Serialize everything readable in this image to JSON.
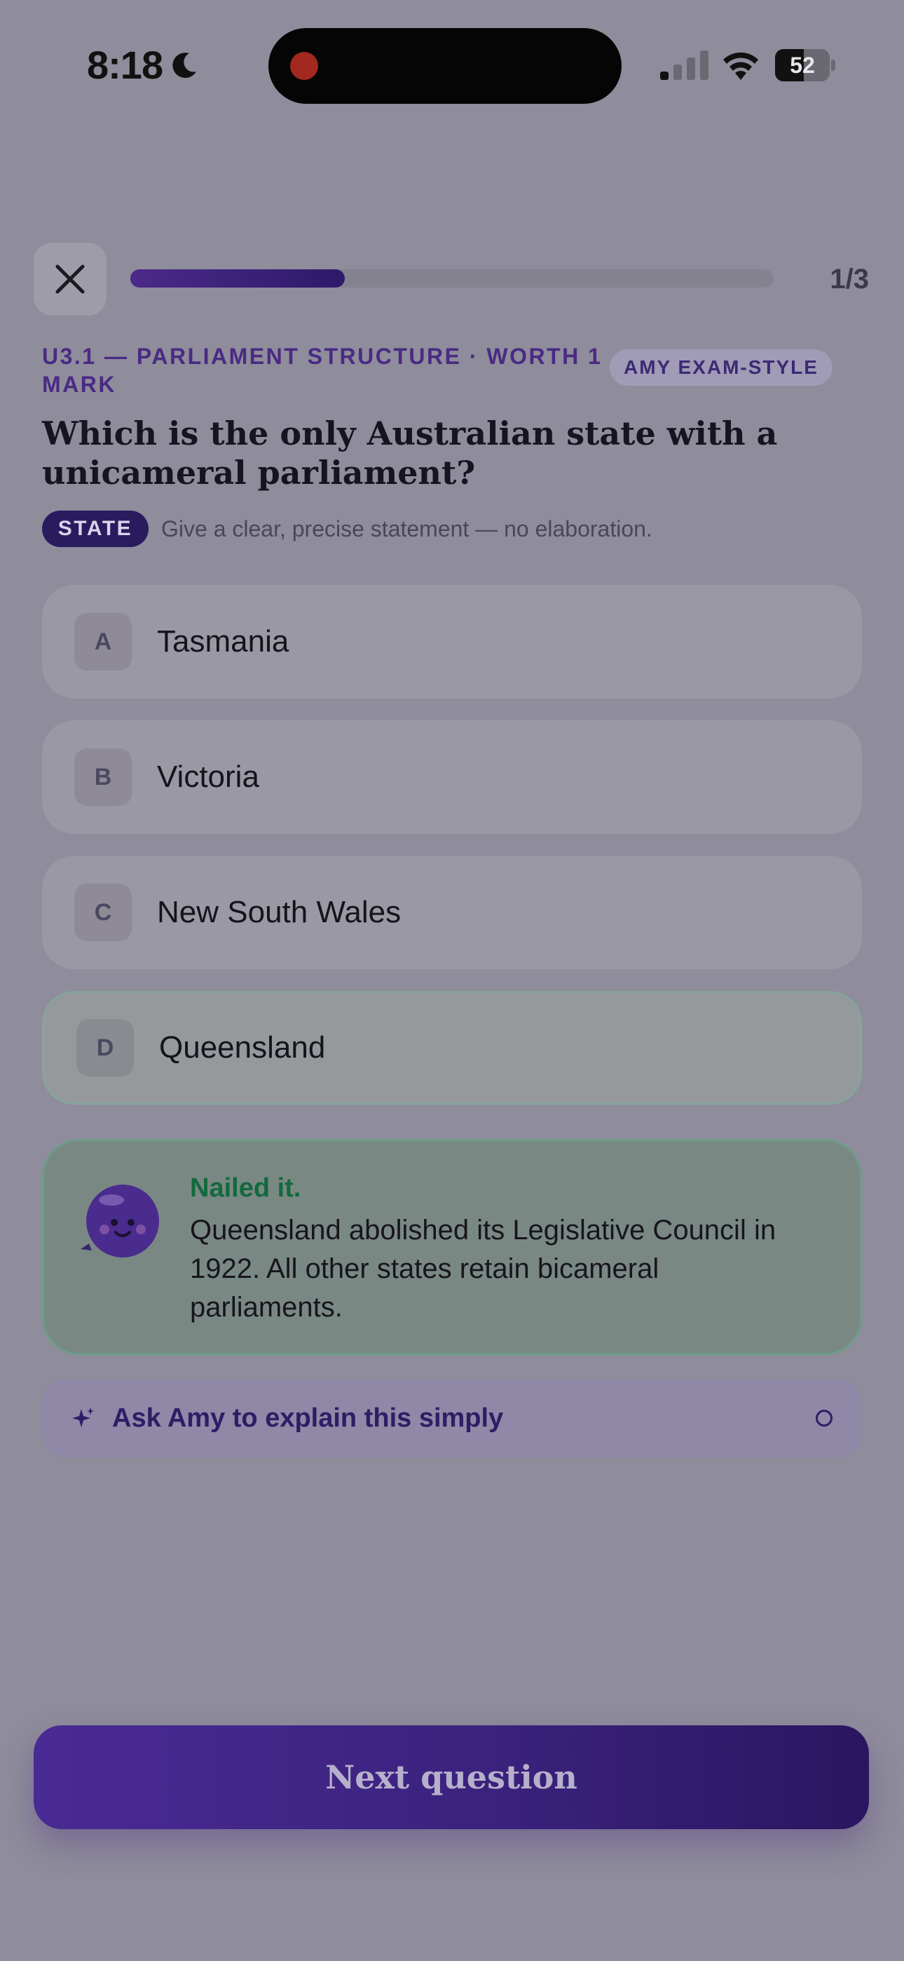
{
  "status_bar": {
    "time": "8:18",
    "battery_label": "52",
    "battery_level": 52,
    "icons": [
      "moon-icon",
      "record-dot-icon",
      "cellular-signal-icon",
      "wifi-icon",
      "battery-icon"
    ]
  },
  "header": {
    "close_icon": "close-icon",
    "progress_current": 1,
    "progress_total": 3,
    "progress_label": "1/3"
  },
  "question": {
    "meta": "U3.1 — PARLIAMENT STRUCTURE · WORTH 1 MARK",
    "badge": "AMY EXAM-STYLE",
    "text": "Which is the only Australian state with a unicameral parliament?",
    "command_word": "STATE",
    "instruction": "Give a clear, precise statement — no elaboration."
  },
  "options": [
    {
      "letter": "A",
      "text": "Tasmania"
    },
    {
      "letter": "B",
      "text": "Victoria"
    },
    {
      "letter": "C",
      "text": "New South Wales"
    },
    {
      "letter": "D",
      "text": "Queensland"
    }
  ],
  "feedback": {
    "title": "Nailed it.",
    "body": "Queensland abolished its Legislative Council in 1922. All other states retain bicameral parliaments.",
    "mascot_icon": "amy-mascot-icon"
  },
  "ask_amy": {
    "label": "Ask Amy to explain this simply",
    "icon": "sparkle-icon"
  },
  "next_button": {
    "label": "Next question"
  },
  "colors": {
    "accent": "#4a2a94",
    "correct_green": "#126a3e",
    "overlay_gray": "#8f8c9b"
  }
}
